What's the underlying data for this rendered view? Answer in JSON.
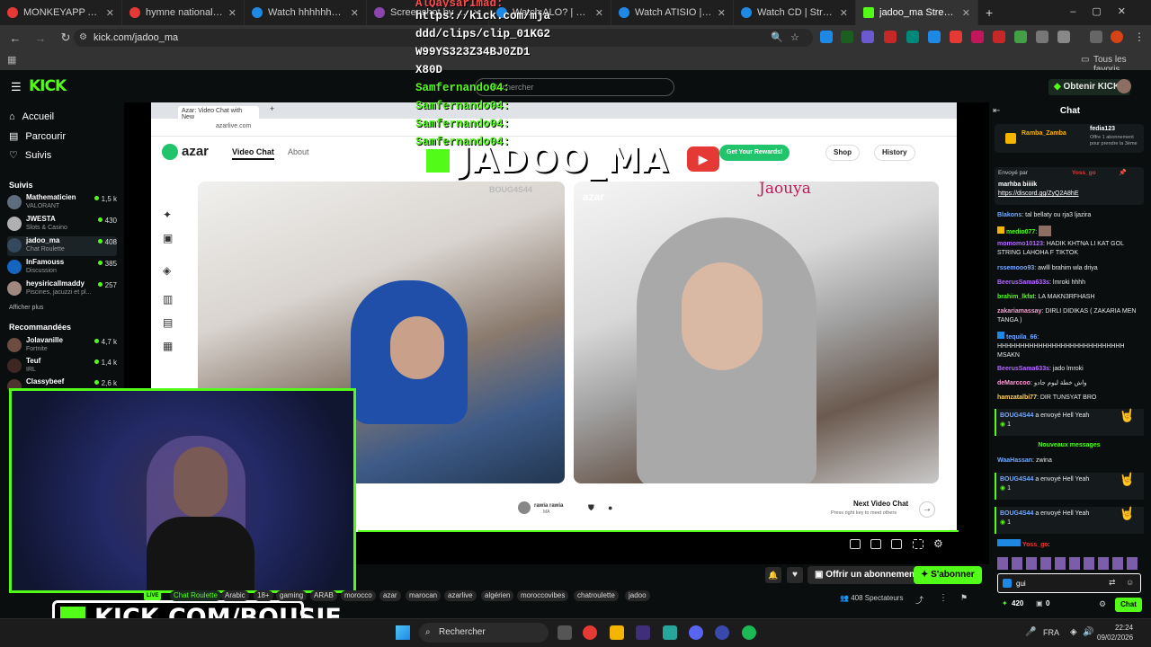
{
  "browser": {
    "tabs": [
      {
        "label": "MONKEYAPP AFTER DARK",
        "color": "#e53935"
      },
      {
        "label": "hymne national marocain",
        "color": "#e53935"
      },
      {
        "label": "Watch hhhhhhhhhhhh |",
        "color": "#1e88e5"
      },
      {
        "label": "Screenshot by Lightshot",
        "color": "#8e44ad"
      },
      {
        "label": "Watch ALO? | Streamable",
        "color": "#1e88e5"
      },
      {
        "label": "Watch ATISIO | Streamable",
        "color": "#1e88e5"
      },
      {
        "label": "Watch CD | Streamable",
        "color": "#1e88e5"
      },
      {
        "label": "jadoo_ma Stream - Watch",
        "color": "#53fc18"
      }
    ],
    "url": "kick.com/jadoo_ma",
    "bookmarks_label": "Tous les favoris"
  },
  "kick": {
    "logo": "KICK",
    "search_placeholder": "Rechercher",
    "get_kicks": "Obtenir KICKs",
    "nav": [
      {
        "label": "Accueil",
        "icon": "home-icon"
      },
      {
        "label": "Parcourir",
        "icon": "browse-icon"
      },
      {
        "label": "Suivis",
        "icon": "heart-icon"
      }
    ],
    "followed_header": "Suivis",
    "followed": [
      {
        "name": "Mathematicien",
        "category": "VALORANT",
        "viewers": "1,5 k"
      },
      {
        "name": "JWESTA",
        "category": "Slots & Casino",
        "viewers": "430"
      },
      {
        "name": "jadoo_ma",
        "category": "Chat Roulette",
        "viewers": "408"
      },
      {
        "name": "InFamouss",
        "category": "Discussion",
        "viewers": "385"
      },
      {
        "name": "heysiricallmaddy",
        "category": "Piscines, jacuzzi et pl...",
        "viewers": "257"
      }
    ],
    "show_more": "Afficher plus",
    "recommended_header": "Recommandées",
    "recommended": [
      {
        "name": "Jolavanille",
        "category": "Fortnite",
        "viewers": "4,7 k"
      },
      {
        "name": "Teuf",
        "category": "IRL",
        "viewers": "1,4 k"
      },
      {
        "name": "Classybeef",
        "category": "",
        "viewers": "2,6 k"
      }
    ]
  },
  "overlay": {
    "clip_lines": [
      {
        "text": "AlQaysarImad:",
        "green": false
      },
      {
        "text": "https://kick.com/mja",
        "green": false
      },
      {
        "text": "ddd/clips/clip_01KG2",
        "green": false
      },
      {
        "text": "W99YS323Z34BJ0ZD1",
        "green": false
      },
      {
        "text": "X80D",
        "green": false
      },
      {
        "text": "Samfernando04:",
        "green": true
      },
      {
        "text": "Samfernando04:",
        "green": true
      },
      {
        "text": "Samfernando04:",
        "green": true
      },
      {
        "text": "Samfernando04:",
        "green": true
      }
    ],
    "big_title": "JADOO_MA",
    "bottom_banner": "KICK.COM/BOUSIF"
  },
  "azar": {
    "tab_title": "Azar: Video Chat with New",
    "address": "azarlive.com",
    "brand": "azar",
    "nav_video_chat": "Video Chat",
    "nav_about": "About",
    "get_rewards": "Get Your Rewards!",
    "shop": "Shop",
    "history": "History",
    "partner_name": "rawia rawia",
    "partner_country": "MA",
    "next_title": "Next Video Chat",
    "next_sub": "Press right key to meet others",
    "watermark_a": "BOUG4S44",
    "watermark_b": "Jaouya"
  },
  "player": {
    "subscribe": "Offrir un abonnement",
    "follow": "S'abonner",
    "tags": [
      "Chat Roulette",
      "Arabic",
      "18+",
      "gaming",
      "ARAB",
      "morocco",
      "azar",
      "marocan",
      "azarlive",
      "algérien",
      "moroccovibes",
      "chatroulette",
      "jadoo"
    ],
    "viewers": "408 Spectateurs",
    "live_badge": "LIVE"
  },
  "chat": {
    "title": "Chat",
    "pinned_user": "Ramba_Zamba",
    "pinned_gifter": "fedia123",
    "pinned_gift_text": "Offre 1 abonnement pour prendre la 3ème",
    "pinned_sender_label": "Envoyé par",
    "pinned_sender": "Yoss_go",
    "pinned_msg": "marhba biiiik",
    "pinned_link": "https://discord.gg/ZyQ2A8hE",
    "messages": [
      {
        "user": "Blakons",
        "text": "tal bellaty ou rja3 ljazira",
        "color": "#74a9ff"
      },
      {
        "user": "medio077",
        "text": "",
        "color": "#53fc18"
      },
      {
        "user": "momomo10123",
        "text": "HADIK KHTNA LI KAT GOL STRING LAHOHA F TIKTOK",
        "color": "#b36bff"
      },
      {
        "user": "rssemooo93",
        "text": "awlll brahim wla driya",
        "color": "#74a9ff"
      },
      {
        "user": "BeerusSama633s",
        "text": "lmroki hhhh",
        "color": "#b36bff"
      },
      {
        "user": "brahim_lkfat",
        "text": "LA MAKN3RFHASH",
        "color": "#53fc18"
      },
      {
        "user": "zakariamassay",
        "text": "DIRLI DIDIKAS ( ZAKARIA MEN TANGA )",
        "color": "#ff9ad5"
      },
      {
        "user": "tequila_66",
        "text": "HHHHHHHHHHHHHHHHHHHHHHHHHHHH MSAKN",
        "color": "#74a9ff"
      },
      {
        "user": "BeerusSama633s",
        "text": "jado lmroki",
        "color": "#b36bff"
      },
      {
        "user": "deMarccoo",
        "text": "واش خطة ليوم جادو",
        "color": "#ff9ad5"
      },
      {
        "user": "hamzatalbi77",
        "text": "DIR TUNSYAT BRO",
        "color": "#ffd166"
      }
    ],
    "gift_user": "BOUG4S44",
    "gift_text": "a envoyé Hell Yeah",
    "gift_count": "1",
    "new_messages": "Nouveaux messages",
    "late_msg_user": "WaaHassan",
    "late_msg_text": "zwina",
    "late_sender": "Yoss_go",
    "input_value": "gui",
    "kicks_count": "420",
    "gift_zero": "0",
    "send_label": "Chat"
  },
  "taskbar": {
    "search": "Rechercher",
    "lang": "FRA",
    "time": "22:24",
    "date": "09/02/2026"
  },
  "colors": {
    "kick_green": "#53fc18",
    "bg": "#0b0e0f"
  }
}
